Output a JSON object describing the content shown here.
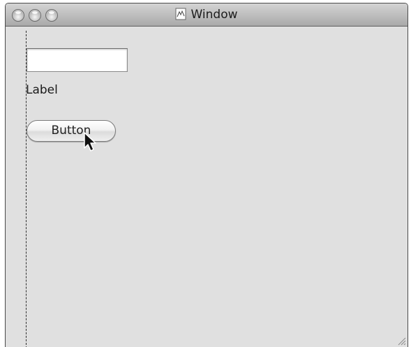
{
  "window": {
    "title": "Window"
  },
  "content": {
    "text_field_value": "",
    "label_text": "Label",
    "button_label": "Button"
  },
  "icons": {
    "title_icon": "document-icon",
    "cursor": "mouse-pointer-icon",
    "resize": "resize-grip-icon"
  }
}
